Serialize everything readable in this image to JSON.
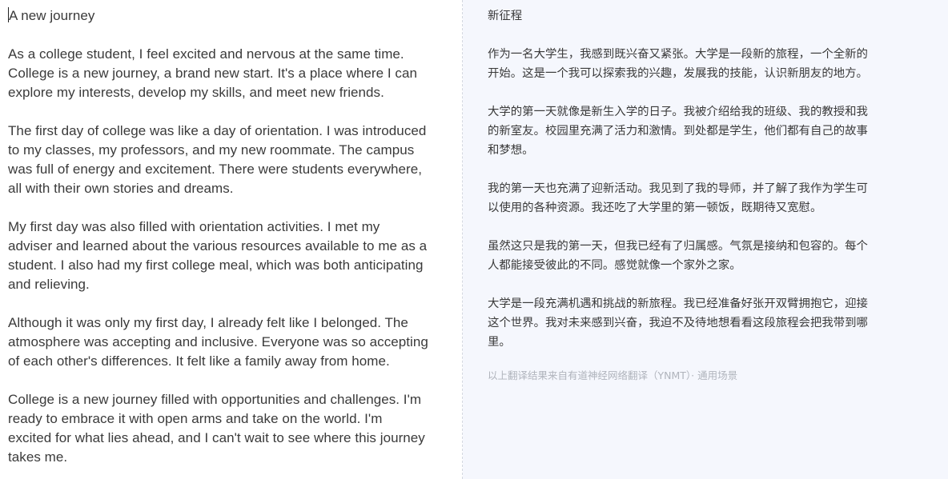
{
  "source": {
    "title": "A new journey",
    "paragraphs": [
      "As a college student, I feel excited and nervous at the same time.\nCollege is a new journey, a brand new start.  It's a place where I can\nexplore my interests, develop my skills, and meet new friends.",
      "The first day of college was like a day of orientation.  I was introduced\nto my classes, my professors, and my new roommate.  The campus\nwas full of energy and excitement.  There were students everywhere,\nall with their own stories and dreams.",
      "My first day was also filled with orientation activities.  I met my\nadviser and learned about the various resources available to me as a\nstudent.  I also had my first college meal, which was both anticipating\nand relieving.",
      "Although it was only my first day, I already felt like I belonged.  The\natmosphere was accepting and inclusive.  Everyone was so accepting\nof each other's differences.  It felt like a family away from home.",
      "College is a new journey filled with opportunities and challenges.  I'm\nready to embrace it with open arms and take on the world.  I'm\nexcited for what lies ahead, and I can't wait to see where this journey\ntakes me."
    ]
  },
  "translation": {
    "title": "新征程",
    "paragraphs": [
      "作为一名大学生，我感到既兴奋又紧张。大学是一段新的旅程，一个全新的\n开始。这是一个我可以探索我的兴趣，发展我的技能，认识新朋友的地方。",
      "大学的第一天就像是新生入学的日子。我被介绍给我的班级、我的教授和我\n的新室友。校园里充满了活力和激情。到处都是学生，他们都有自己的故事\n和梦想。",
      "我的第一天也充满了迎新活动。我见到了我的导师，并了解了我作为学生可\n以使用的各种资源。我还吃了大学里的第一顿饭，既期待又宽慰。",
      "虽然这只是我的第一天，但我已经有了归属感。气氛是接纳和包容的。每个\n人都能接受彼此的不同。感觉就像一个家外之家。",
      "大学是一段充满机遇和挑战的新旅程。我已经准备好张开双臂拥抱它，迎接\n这个世界。我对未来感到兴奋，我迫不及待地想看看这段旅程会把我带到哪\n里。"
    ],
    "footer": "以上翻译结果来自有道神经网络翻译（YNMT）· 通用场景"
  },
  "colors": {
    "left_background": "#ffffff",
    "right_background": "#f5f7fd",
    "text": "#3a3a3a",
    "footer_text": "#b0b4bc",
    "divider": "#d4d8e0"
  }
}
